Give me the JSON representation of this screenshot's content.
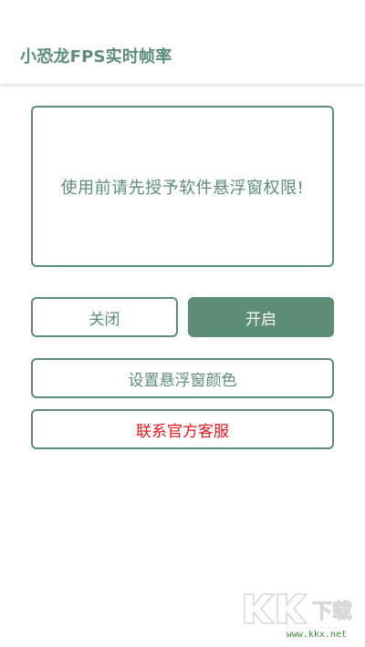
{
  "app_bar": {
    "title": "小恐龙FPS实时帧率"
  },
  "message": {
    "text": "使用前请先授予软件悬浮窗权限!"
  },
  "buttons": {
    "close_label": "关闭",
    "open_label": "开启",
    "set_color_label": "设置悬浮窗颜色",
    "contact_support_label": "联系官方客服"
  },
  "watermark": {
    "logo_text": "KK下载",
    "url": "www.kkx.net"
  },
  "colors": {
    "accent": "#5b8d77",
    "danger_text": "#e4151b",
    "background": "#ffffff"
  }
}
